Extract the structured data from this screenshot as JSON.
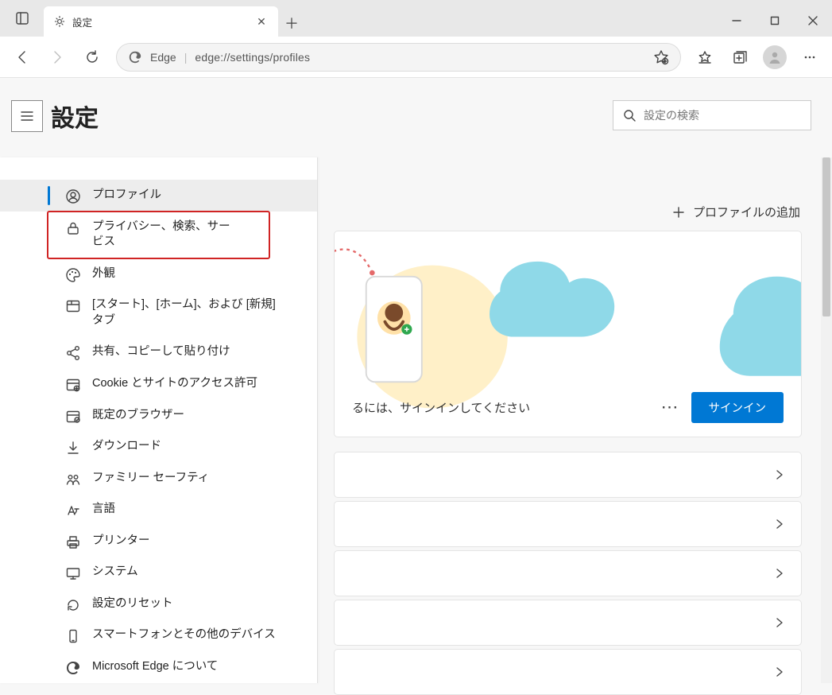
{
  "window": {
    "tab_title": "設定",
    "address_brand": "Edge",
    "address_url": "edge://settings/profiles"
  },
  "page": {
    "title": "設定",
    "search_placeholder": "設定の検索",
    "add_profile": "プロファイルの追加"
  },
  "sidebar": {
    "items": [
      {
        "label": "プロファイル",
        "icon": "person-circle-icon"
      },
      {
        "label": "プライバシー、検索、サービス",
        "icon": "lock-icon"
      },
      {
        "label": "外観",
        "icon": "palette-icon"
      },
      {
        "label": "[スタート]、[ホーム]、および [新規] タブ",
        "icon": "window-tabs-icon"
      },
      {
        "label": "共有、コピーして貼り付け",
        "icon": "share-icon"
      },
      {
        "label": "Cookie とサイトのアクセス許可",
        "icon": "cookie-icon"
      },
      {
        "label": "既定のブラウザー",
        "icon": "browser-default-icon"
      },
      {
        "label": "ダウンロード",
        "icon": "download-icon"
      },
      {
        "label": "ファミリー セーフティ",
        "icon": "family-icon"
      },
      {
        "label": "言語",
        "icon": "language-icon"
      },
      {
        "label": "プリンター",
        "icon": "printer-icon"
      },
      {
        "label": "システム",
        "icon": "system-icon"
      },
      {
        "label": "設定のリセット",
        "icon": "reset-icon"
      },
      {
        "label": "スマートフォンとその他のデバイス",
        "icon": "phone-icon"
      },
      {
        "label": "Microsoft Edge について",
        "icon": "edge-icon"
      }
    ]
  },
  "hero": {
    "prompt_fragment": "るには、サインインしてください",
    "signin": "サインイン"
  }
}
